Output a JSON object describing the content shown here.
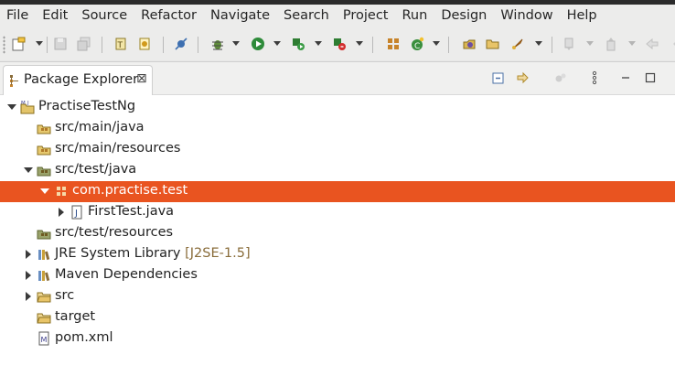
{
  "menubar": {
    "items": [
      "File",
      "Edit",
      "Source",
      "Refactor",
      "Navigate",
      "Search",
      "Project",
      "Run",
      "Design",
      "Window",
      "Help"
    ]
  },
  "toolbar": {
    "icons": [
      "new-icon",
      "save-icon",
      "save-all-icon",
      "open-type-icon",
      "open-resource-icon",
      "skip-breakpoints-icon",
      "debug-icon",
      "run-icon",
      "coverage-icon",
      "external-tools-icon",
      "new-java-package-icon",
      "new-java-class-icon",
      "open-task-icon",
      "open-folder-icon",
      "launch-icon",
      "next-annotation-icon",
      "previous-annotation-icon",
      "back-icon"
    ]
  },
  "view": {
    "tab_label": "Package Explorer",
    "tab_icon": "package-explorer-icon",
    "close_glyph": "⊠"
  },
  "tree": {
    "rows": [
      {
        "label": "PractiseTestNg",
        "icon": "maven-project-icon",
        "expanded": true,
        "selected": false
      },
      {
        "label": "src/main/java",
        "icon": "source-folder-icon"
      },
      {
        "label": "src/main/resources",
        "icon": "source-folder-icon"
      },
      {
        "label": "src/test/java",
        "icon": "source-folder-icon",
        "expanded": true
      },
      {
        "label": "com.practise.test",
        "icon": "package-icon",
        "expanded": true,
        "selected": true
      },
      {
        "label": "FirstTest.java",
        "icon": "java-file-icon",
        "expanded": false
      },
      {
        "label": "src/test/resources",
        "icon": "source-folder-icon"
      },
      {
        "label": "JRE System Library",
        "decoration": "[J2SE-1.5]",
        "icon": "library-icon",
        "expanded": false
      },
      {
        "label": "Maven Dependencies",
        "icon": "library-icon",
        "expanded": false
      },
      {
        "label": "src",
        "icon": "folder-icon",
        "expanded": false
      },
      {
        "label": "target",
        "icon": "folder-icon"
      },
      {
        "label": "pom.xml",
        "icon": "maven-file-icon"
      }
    ]
  },
  "colors": {
    "selection": "#e95420",
    "window_bg": "#ececeb"
  }
}
